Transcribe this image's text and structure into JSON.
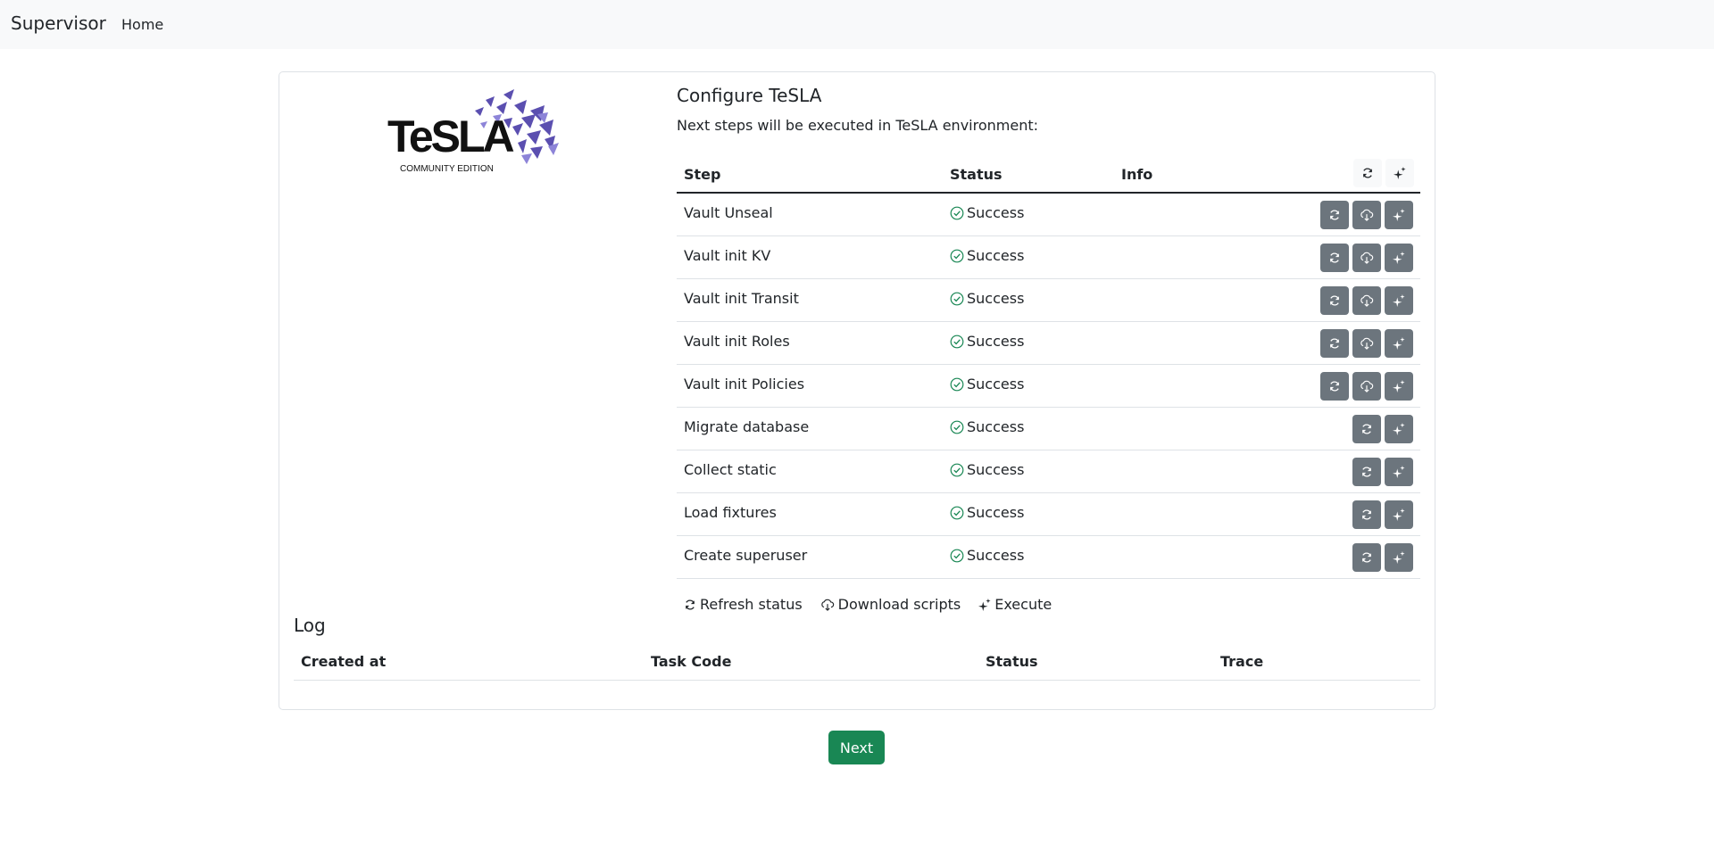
{
  "navbar": {
    "brand": "Supervisor",
    "home": "Home"
  },
  "logo": {
    "text": "TeSLA",
    "edition": "COMMUNITY EDITION"
  },
  "configure": {
    "title": "Configure TeSLA",
    "subtitle": "Next steps will be executed in TeSLA environment:",
    "columns": {
      "step": "Step",
      "status": "Status",
      "info": "Info"
    },
    "rows": [
      {
        "step": "Vault Unseal",
        "status": "Success",
        "download": true
      },
      {
        "step": "Vault init KV",
        "status": "Success",
        "download": true
      },
      {
        "step": "Vault init Transit",
        "status": "Success",
        "download": true
      },
      {
        "step": "Vault init Roles",
        "status": "Success",
        "download": true
      },
      {
        "step": "Vault init Policies",
        "status": "Success",
        "download": true
      },
      {
        "step": "Migrate database",
        "status": "Success",
        "download": false
      },
      {
        "step": "Collect static",
        "status": "Success",
        "download": false
      },
      {
        "step": "Load fixtures",
        "status": "Success",
        "download": false
      },
      {
        "step": "Create superuser",
        "status": "Success",
        "download": false
      }
    ],
    "legend": {
      "refresh": "Refresh status",
      "download": "Download scripts",
      "execute": "Execute"
    }
  },
  "log": {
    "title": "Log",
    "columns": {
      "created_at": "Created at",
      "task_code": "Task Code",
      "status": "Status",
      "trace": "Trace"
    }
  },
  "next_label": "Next",
  "colors": {
    "success": "#198754",
    "button_gray": "#6c757d",
    "navbar": "#f8f9fa"
  },
  "icons": {
    "refresh": "refresh-icon",
    "download": "cloud-download-icon",
    "execute": "sparkle-icon",
    "status": "check-circle-icon"
  }
}
